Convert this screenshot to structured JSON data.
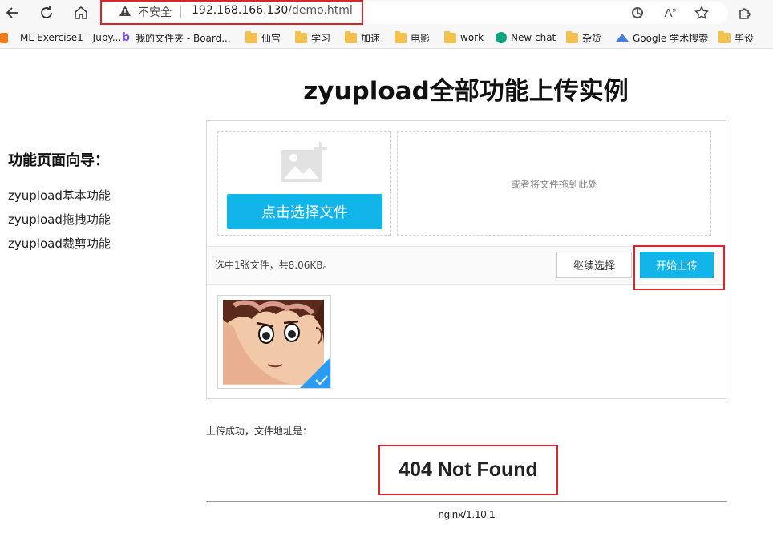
{
  "browser": {
    "insecure_label": "不安全",
    "url_host": "192.168.166.130",
    "url_path": "/demo.html",
    "font_icon_text": "Aᴬ"
  },
  "bookmarks": [
    {
      "label": "ML-Exercise1 - Jupy...",
      "icon": "jupyter-icon"
    },
    {
      "label": "我的文件夹 - Board...",
      "icon": "bing-icon"
    },
    {
      "label": "仙宫",
      "icon": "folder-icon"
    },
    {
      "label": "学习",
      "icon": "folder-icon"
    },
    {
      "label": "加速",
      "icon": "folder-icon"
    },
    {
      "label": "电影",
      "icon": "folder-icon"
    },
    {
      "label": "work",
      "icon": "folder-icon"
    },
    {
      "label": "New chat",
      "icon": "chatgpt-icon"
    },
    {
      "label": "杂货",
      "icon": "folder-icon"
    },
    {
      "label": "Google 学术搜索",
      "icon": "scholar-icon"
    },
    {
      "label": "毕设",
      "icon": "folder-icon"
    }
  ],
  "page": {
    "title": "zyupload全部功能上传实例"
  },
  "sidebar": {
    "heading": "功能页面向导：",
    "links": [
      "zyupload基本功能",
      "zyupload拖拽功能",
      "zyupload裁剪功能"
    ]
  },
  "uploader": {
    "pick_button": "点击选择文件",
    "drop_hint": "或者将文件拖到此处",
    "status": "选中1张文件，共8.06KB。",
    "continue_button": "继续选择",
    "start_button": "开始上传"
  },
  "result": {
    "label": "上传成功，文件地址是：",
    "error_title": "404 Not Found",
    "server": "nginx/1.10.1"
  },
  "colors": {
    "accent": "#12b5e9",
    "highlight_red": "#d9252c"
  }
}
